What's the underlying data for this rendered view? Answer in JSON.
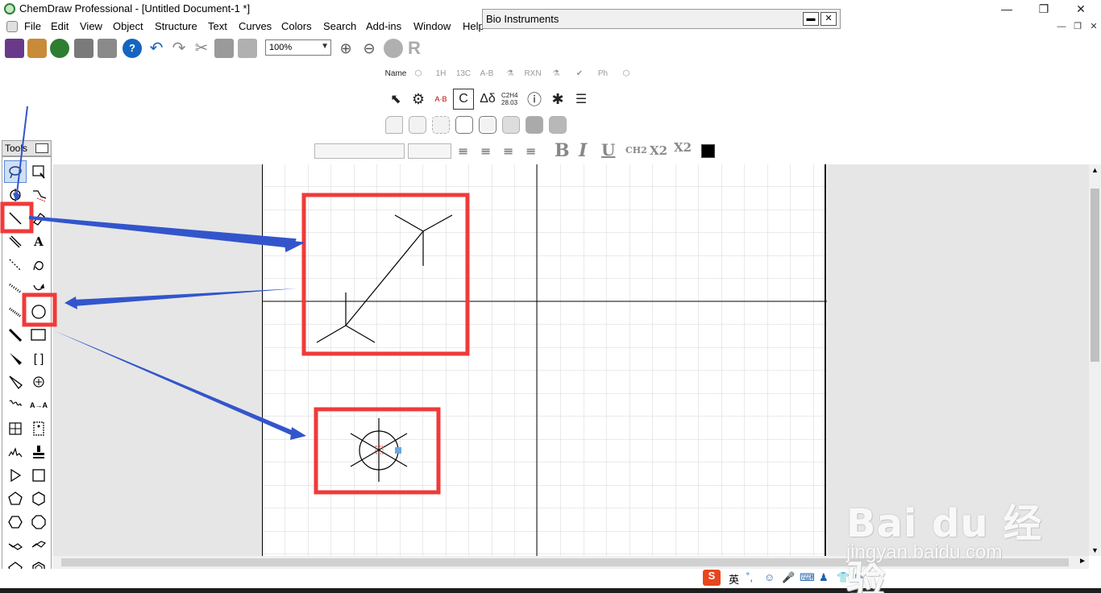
{
  "window": {
    "title": "ChemDraw Professional - [Untitled Document-1 *]",
    "minimize": "—",
    "maximize": "❐",
    "close": "✕"
  },
  "menu": {
    "items": [
      "File",
      "Edit",
      "View",
      "Object",
      "Structure",
      "Text",
      "Curves",
      "Colors",
      "Search",
      "Add-ins",
      "Window",
      "Help"
    ]
  },
  "toolbar": {
    "zoom_value": "100%"
  },
  "bio_window": {
    "title": "Bio Instruments",
    "restore_label": "▬",
    "close_label": "✕"
  },
  "bio_tools": {
    "row1": [
      "Name",
      "1H",
      "13C",
      "A-B",
      "RXN",
      "Ph"
    ],
    "row2_labels": [
      "A·B",
      "C",
      "Δδ",
      "C2H4 28.03"
    ]
  },
  "format_bar": {
    "bold": "B",
    "italic": "I",
    "underline": "U",
    "formula": "CH2",
    "subscript": "X2",
    "superscript": "X2",
    "color": "#000000"
  },
  "tools_palette": {
    "title": "Tools",
    "text_tool": "A",
    "brackets_tool": "[ ]",
    "atom_map": "A→A"
  },
  "ime_bar": {
    "lang": "英"
  },
  "watermark": {
    "logo": "Bai du 经验",
    "url": "jingyan.baidu.com"
  },
  "colors": {
    "highlight_box": "#f03a3a",
    "arrow": "#3355cc",
    "canvas_gray": "#e6e6e6"
  }
}
